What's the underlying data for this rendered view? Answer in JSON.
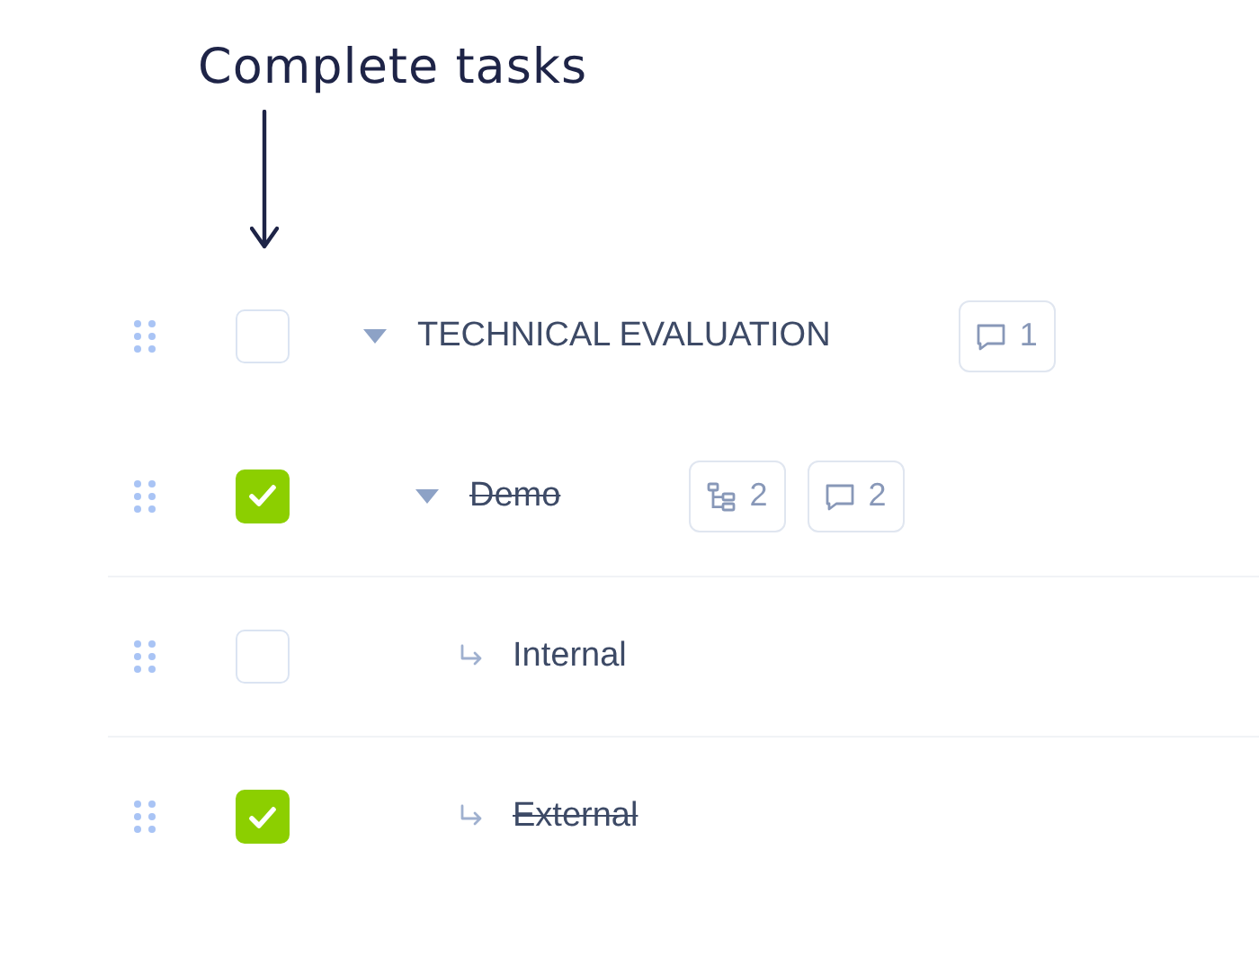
{
  "annotation": {
    "text": "Complete tasks"
  },
  "tasks": [
    {
      "title": "TECHNICAL EVALUATION",
      "checked": false,
      "expanded": true,
      "badges": [
        {
          "kind": "comments",
          "count": "1"
        }
      ],
      "children": [
        {
          "title": "Demo",
          "checked": true,
          "expanded": true,
          "badges": [
            {
              "kind": "subtasks",
              "count": "2"
            },
            {
              "kind": "comments",
              "count": "2"
            }
          ],
          "children": [
            {
              "title": "Internal",
              "checked": false
            },
            {
              "title": "External",
              "checked": true
            }
          ]
        }
      ]
    }
  ]
}
